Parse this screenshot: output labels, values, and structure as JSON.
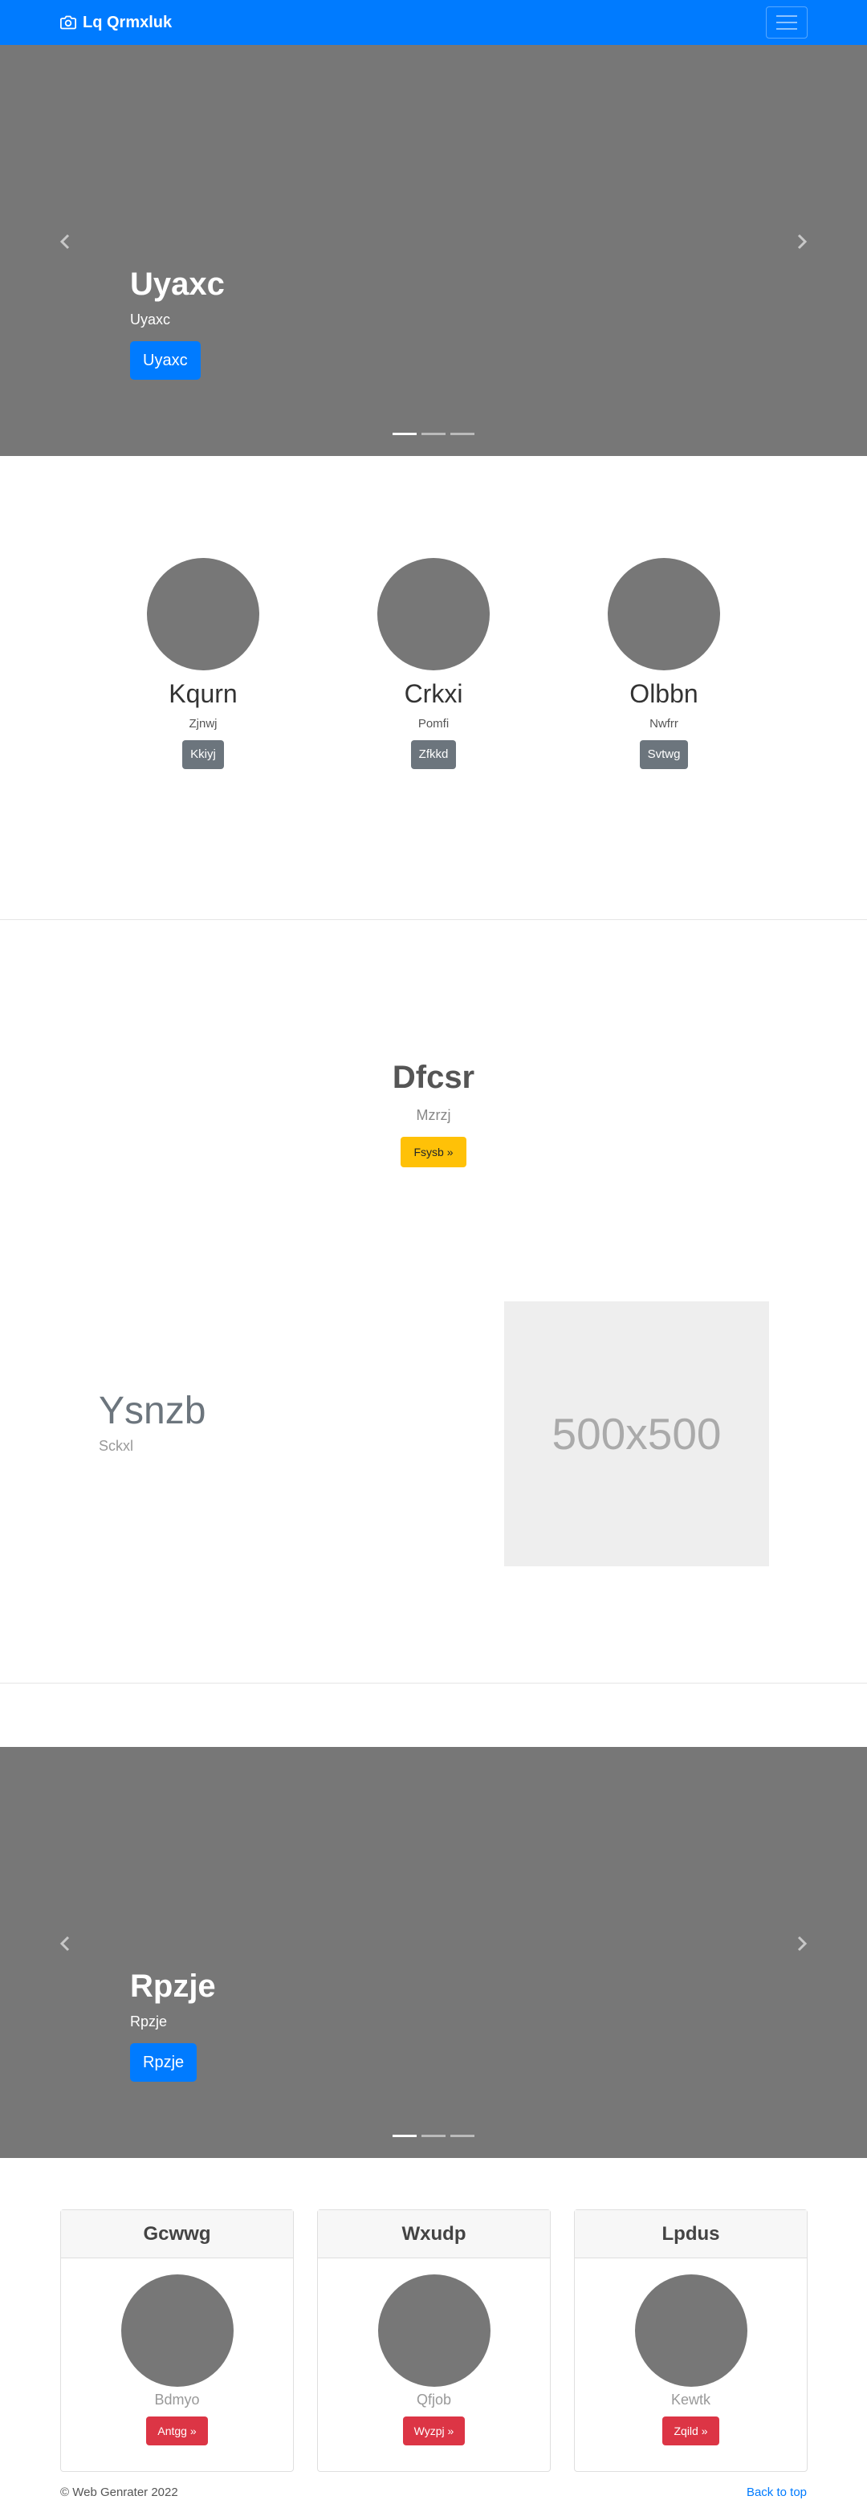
{
  "navbar": {
    "brand": "Lq Qrmxluk",
    "brand_icon": "camera-icon",
    "toggler_icon": "hamburger-icon"
  },
  "carousel1": {
    "title": "Uyaxc",
    "subtitle": "Uyaxc",
    "button": "Uyaxc",
    "slides": 3,
    "active_slide": 1
  },
  "marketing": [
    {
      "heading": "Kqurn",
      "text": "Zjnwj",
      "button": "Kkiyj"
    },
    {
      "heading": "Crkxi",
      "text": "Pomfi",
      "button": "Zfkkd"
    },
    {
      "heading": "Olbbn",
      "text": "Nwfrr",
      "button": "Svtwg"
    }
  ],
  "feature": {
    "heading": "Dfcsr",
    "text": "Mzrzj",
    "button": "Fsysb »"
  },
  "featurette": {
    "heading": "Ysnzb",
    "text": "Sckxl",
    "image_label": "500x500"
  },
  "carousel2": {
    "title": "Rpzje",
    "subtitle": "Rpzje",
    "button": "Rpzje",
    "slides": 3,
    "active_slide": 1
  },
  "cards": [
    {
      "header": "Gcwwg",
      "text": "Bdmyo",
      "button": "Antgg »"
    },
    {
      "header": "Wxudp",
      "text": "Qfjob",
      "button": "Wyzpj »"
    },
    {
      "header": "Lpdus",
      "text": "Kewtk",
      "button": "Zqild »"
    }
  ],
  "footer": {
    "copyright": "© Web Genrater 2022",
    "back_to_top": "Back to top"
  },
  "colors": {
    "primary": "#007bff",
    "secondary": "#6c757d",
    "warning": "#ffc107",
    "danger": "#dc3545",
    "placeholder_bg": "#777777"
  }
}
